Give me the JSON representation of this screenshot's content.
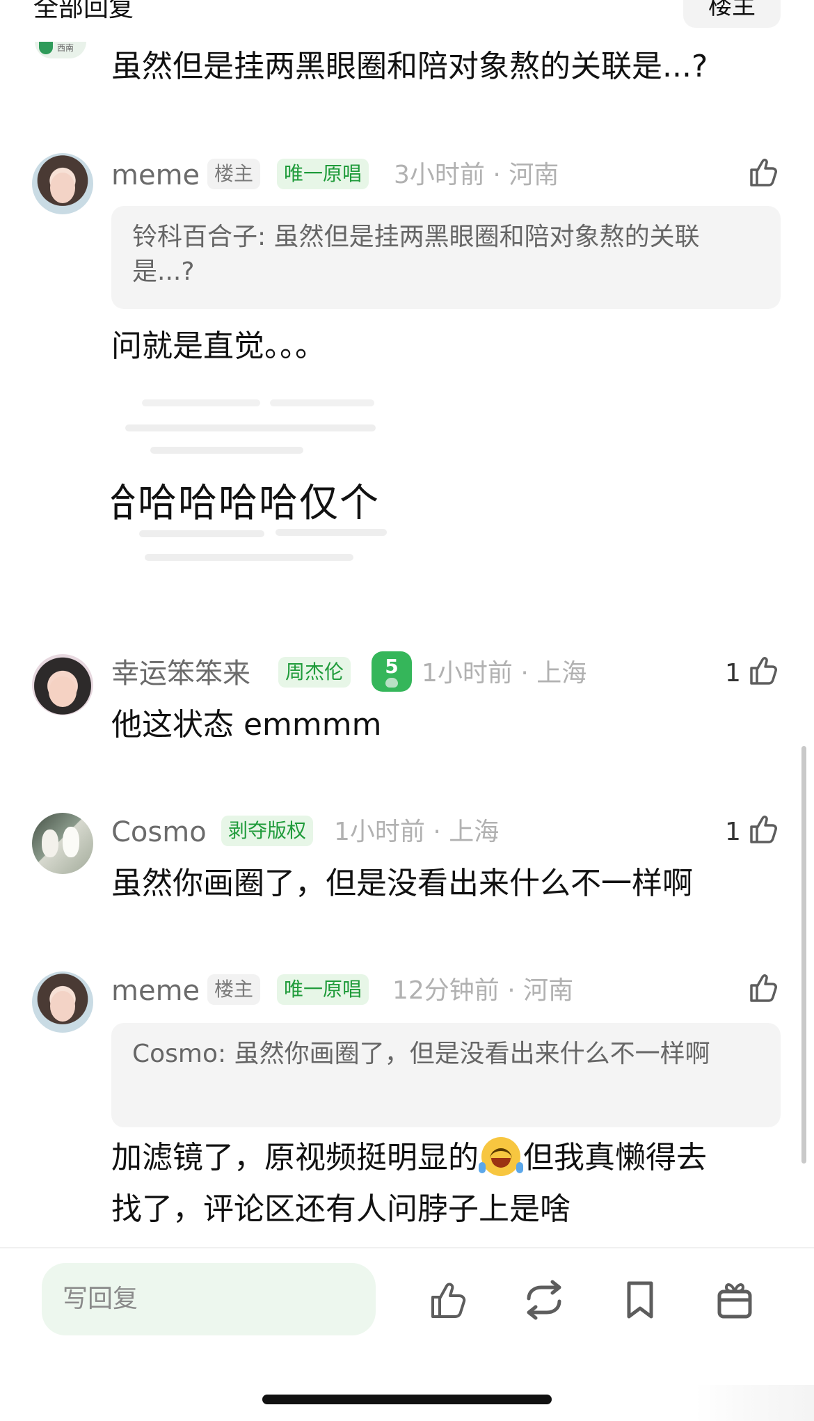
{
  "header": {
    "left_label": "全部回复",
    "right_label": "楼主"
  },
  "top_reply": {
    "text": "虽然但是挂两黑眼圈和陪对象熬的关联是...?"
  },
  "comments": [
    {
      "name": "meme",
      "badge1": "楼主",
      "badge2": "唯一原唱",
      "meta": "3小时前 · 河南",
      "quote_name": "铃科百合子:",
      "quote_text": "虽然但是挂两黑眼圈和陪对象熬的关联是...?",
      "body": "问就是直觉。。。",
      "image_text": "哈哈哈哈哈仅个"
    },
    {
      "name": "幸运笨笨来",
      "badge": "周杰伦",
      "level": "5",
      "meta": "1小时前 · 上海",
      "likes": "1",
      "body": "他这状态 emmmm"
    },
    {
      "name": "Cosmo",
      "badge": "剥夺版权",
      "meta": "1小时前 · 上海",
      "likes": "1",
      "body": "虽然你画圈了，但是没看出来什么不一样啊"
    },
    {
      "name": "meme",
      "badge1": "楼主",
      "badge2": "唯一原唱",
      "meta": "12分钟前 · 河南",
      "quote_name": "Cosmo:",
      "quote_text": "虽然你画圈了，但是没看出来什么不一样啊",
      "body_line1_a": "加滤镜了，原视频挺明显的",
      "body_line1_b": "但我真懒得去",
      "body_line2": "找了，评论区还有人问脖子上是啥"
    }
  ],
  "bottom_bar": {
    "reply_placeholder": "写回复",
    "icons": [
      "like-icon",
      "repost-icon",
      "bookmark-icon",
      "gift-icon"
    ]
  }
}
